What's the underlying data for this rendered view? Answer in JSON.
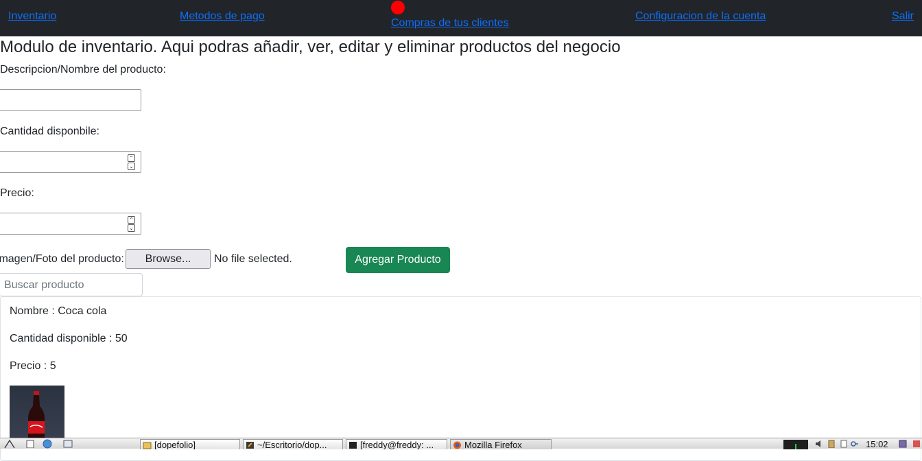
{
  "nav": {
    "items": [
      "Inventario",
      "Metodos de pago",
      "Compras de tus clientes",
      "Configuracion de la cuenta",
      "Salir"
    ],
    "notification_color": "#ff0000"
  },
  "main": {
    "title": "Modulo de inventario. Aqui podras añadir, ver, editar y eliminar productos del negocio",
    "form": {
      "description_label": "Descripcion/Nombre del producto:",
      "quantity_label": "Cantidad disponbile:",
      "price_label": "Precio:",
      "image_label": "Imagen/Foto del producto:",
      "browse_label": "Browse...",
      "no_file_text": "No file selected.",
      "submit_label": "Agregar Producto"
    },
    "search": {
      "placeholder": "Buscar producto"
    },
    "product": {
      "name_text": "Nombre : Coca cola",
      "quantity_text": "Cantidad disponible : 50",
      "price_text": "Precio : 5"
    }
  },
  "taskbar": {
    "tasks": [
      "[dopefolio]",
      "~/Escritorio/dop...",
      "[freddy@freddy: ...",
      "Mozilla Firefox"
    ],
    "clock": "15:02"
  },
  "colors": {
    "nav_bg": "#212529",
    "link": "#0d6efd",
    "success": "#198754"
  }
}
